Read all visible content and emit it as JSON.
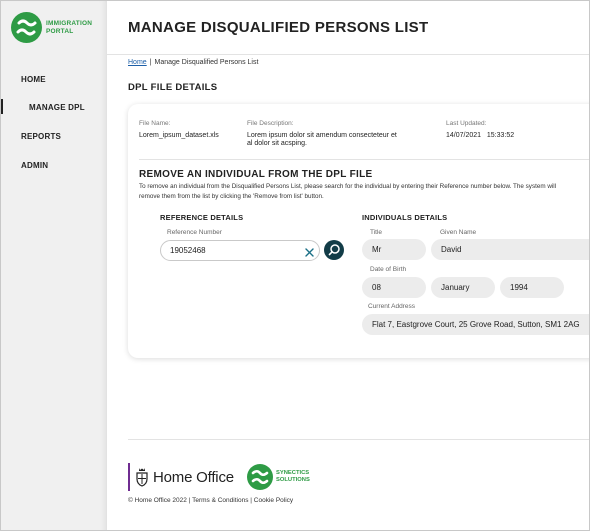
{
  "brand": {
    "line1": "IMMIGRATION",
    "line2": "PORTAL",
    "color": "#2e9b45"
  },
  "nav": {
    "home": "HOME",
    "manage_dpl": "MANAGE DPL",
    "reports": "REPORTS",
    "admin": "ADMIN"
  },
  "page": {
    "title": "MANAGE DISQUALIFIED PERSONS LIST"
  },
  "breadcrumb": {
    "home": "Home",
    "current": "Manage Disqualified Persons List"
  },
  "file_details": {
    "heading": "DPL FILE DETAILS",
    "file_name_label": "File Name:",
    "file_name": "Lorem_ipsum_dataset.xls",
    "description_label": "File Description:",
    "description_line1": "Lorem ipsum dolor sit amendum consecteteur et",
    "description_line2": "al dolor sit acsping.",
    "updated_label": "Last Updated:",
    "updated_date": "14/07/2021",
    "updated_time": "15:33:52"
  },
  "remove": {
    "heading": "REMOVE AN INDIVIDUAL FROM THE DPL FILE",
    "desc_line1": "To remove an individual from the Disqualified Persons List, please search for the individual by entering their Reference number below. The system will",
    "desc_line2": "remove them from the list by clicking the 'Remove from list' button."
  },
  "reference": {
    "heading": "REFERENCE DETAILS",
    "label": "Reference Number",
    "value": "19052468"
  },
  "individual": {
    "heading": "INDIVIDUALS DETAILS",
    "title_label": "Title",
    "title": "Mr",
    "given_name_label": "Given Name",
    "given_name": "David",
    "dob_label": "Date of Birth",
    "dob_day": "08",
    "dob_month": "January",
    "dob_year": "1994",
    "address_label": "Current Address",
    "address": "Flat 7, Eastgrove Court, 25 Grove Road, Sutton, SM1 2AG"
  },
  "footer": {
    "home_office": "Home Office",
    "synectics_line1": "SYNECTICS",
    "synectics_line2": "SOLUTIONS",
    "copyright": "© Home Office 2022",
    "terms": "Terms & Conditions",
    "cookie": "Cookie Policy",
    "divider": "|",
    "accent_purple": "#6f2c91"
  },
  "icons": {
    "brand_logo": "portal-logo-icon",
    "clear": "close-icon",
    "search": "search-icon",
    "crest": "crest-icon"
  }
}
